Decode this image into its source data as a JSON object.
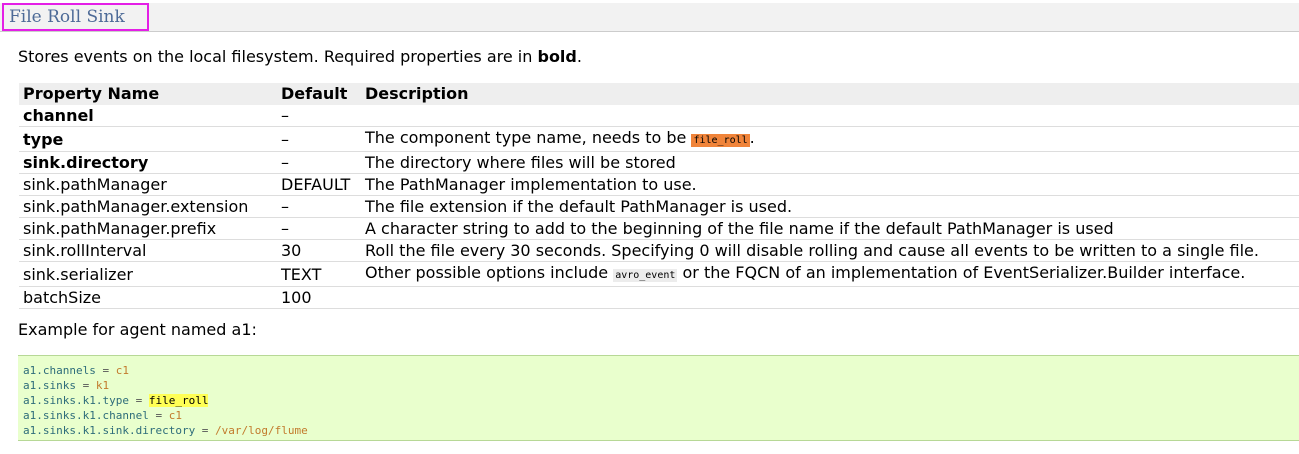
{
  "page": {
    "title": "File Roll Sink",
    "intro_text": "Stores events on the local filesystem. Required properties are in ",
    "intro_bold": "bold",
    "intro_end": "."
  },
  "table": {
    "headers": [
      "Property Name",
      "Default",
      "Description"
    ],
    "rows": [
      {
        "name": "channel",
        "default": "–",
        "description": ""
      },
      {
        "name": "type",
        "default": "–",
        "desc_before": "The component type name, needs to be ",
        "desc_code": "file_roll",
        "desc_after": "."
      },
      {
        "name": "sink.directory",
        "default": "–",
        "description": "The directory where files will be stored"
      },
      {
        "name": "sink.pathManager",
        "default": "DEFAULT",
        "description": "The PathManager implementation to use."
      },
      {
        "name": "sink.pathManager.extension",
        "default": "–",
        "description": "The file extension if the default PathManager is used."
      },
      {
        "name": "sink.pathManager.prefix",
        "default": "–",
        "description": "A character string to add to the beginning of the file name if the default PathManager is used"
      },
      {
        "name": "sink.rollInterval",
        "default": "30",
        "description": "Roll the file every 30 seconds. Specifying 0 will disable rolling and cause all events to be written to a single file."
      },
      {
        "name": "sink.serializer",
        "default": "TEXT",
        "desc_before": "Other possible options include ",
        "desc_code": "avro_event",
        "desc_after": " or the FQCN of an implementation of EventSerializer.Builder interface."
      },
      {
        "name": "batchSize",
        "default": "100",
        "description": ""
      }
    ]
  },
  "example": {
    "label": "Example for agent named a1:",
    "lines": [
      {
        "key": "a1.channels",
        "op": " = ",
        "value": "c1"
      },
      {
        "key": "a1.sinks",
        "op": " = ",
        "value": "k1"
      },
      {
        "key": "a1.sinks.k1.type",
        "op": " = ",
        "value": "file_roll"
      },
      {
        "key": "a1.sinks.k1.channel",
        "op": " = ",
        "value": "c1"
      },
      {
        "key": "a1.sinks.k1.sink.directory",
        "op": " = ",
        "value": "/var/log/flume"
      }
    ]
  },
  "colors": {
    "title_border": "#e41fe6",
    "title_text": "#4d6a97",
    "code_background": "#e9ffcd",
    "inline_code_highlight": "#f0843a",
    "code_value_highlight": "#ffff55"
  }
}
